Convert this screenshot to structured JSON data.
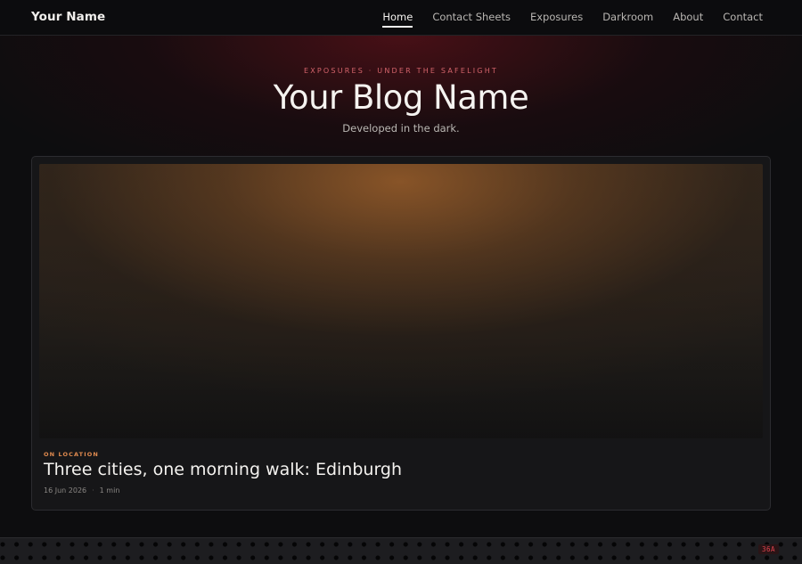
{
  "header": {
    "brand": "Your Name",
    "nav": [
      {
        "label": "Home",
        "active": true
      },
      {
        "label": "Contact Sheets",
        "active": false
      },
      {
        "label": "Exposures",
        "active": false
      },
      {
        "label": "Darkroom",
        "active": false
      },
      {
        "label": "About",
        "active": false
      },
      {
        "label": "Contact",
        "active": false
      }
    ]
  },
  "hero": {
    "eyebrow": "EXPOSURES · UNDER THE SAFELIGHT",
    "title": "Your Blog Name",
    "tagline": "Developed in the dark."
  },
  "featured_post": {
    "category": "ON LOCATION",
    "title": "Three cities, one morning walk: Edinburgh",
    "date": "16 Jun 2026",
    "separator": "·",
    "read_time": "1 min"
  },
  "film_strip": {
    "frame_code": "36A"
  },
  "colors": {
    "accent_red": "#d2636a",
    "category_orange": "#e08a4f",
    "background": "#0d0d0f"
  }
}
